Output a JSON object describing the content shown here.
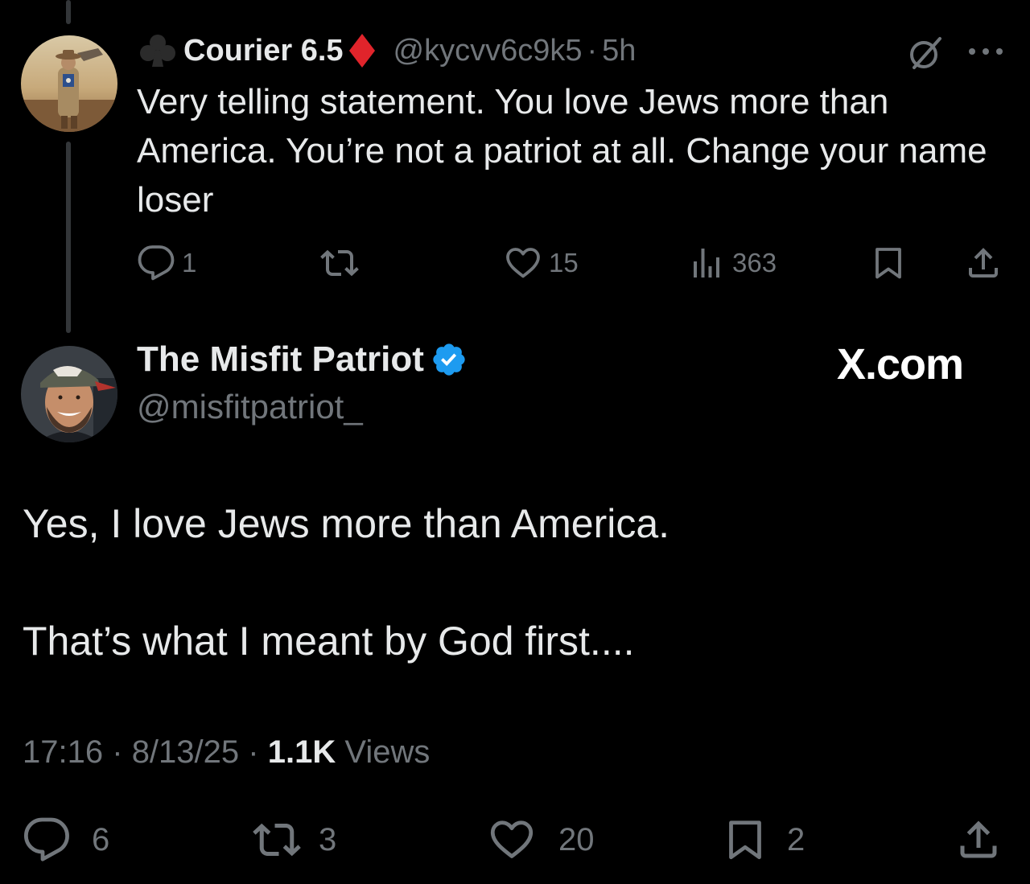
{
  "reply_tweet": {
    "author_name": "Courier 6.5",
    "handle": "@kycvv6c9k5",
    "separator": "·",
    "time": "5h",
    "text": "Very telling statement. You love Jews more than America. You’re not a patriot at all. Change your name loser",
    "reply_count": "1",
    "retweet_count": "",
    "like_count": "15",
    "view_count": "363",
    "icons": {
      "name_prefix": "club-icon",
      "name_suffix": "diamond-icon",
      "top_right": [
        "grok-icon",
        "more-icon"
      ],
      "actions": [
        "reply-icon",
        "retweet-icon",
        "like-icon",
        "views-icon",
        "bookmark-icon",
        "share-icon"
      ]
    }
  },
  "main_tweet": {
    "author_name": "The Misfit Patriot",
    "handle": "@misfitpatriot_",
    "verified": true,
    "paragraphs": [
      "Yes, I love Jews more than America.",
      "That’s what I meant by God first...."
    ],
    "time": "17:16",
    "date": "8/13/25",
    "separator": "·",
    "views_count": "1.1K",
    "views_label": "Views",
    "reply_count": "6",
    "retweet_count": "3",
    "like_count": "20",
    "bookmark_count": "2"
  },
  "watermark": "X.com",
  "colors": {
    "background": "#000000",
    "primary_text": "#e7e9ea",
    "secondary_text": "#71767b",
    "verified_blue": "#1d9bf0",
    "diamond_red": "#e0242b",
    "thread_line": "#333639"
  }
}
